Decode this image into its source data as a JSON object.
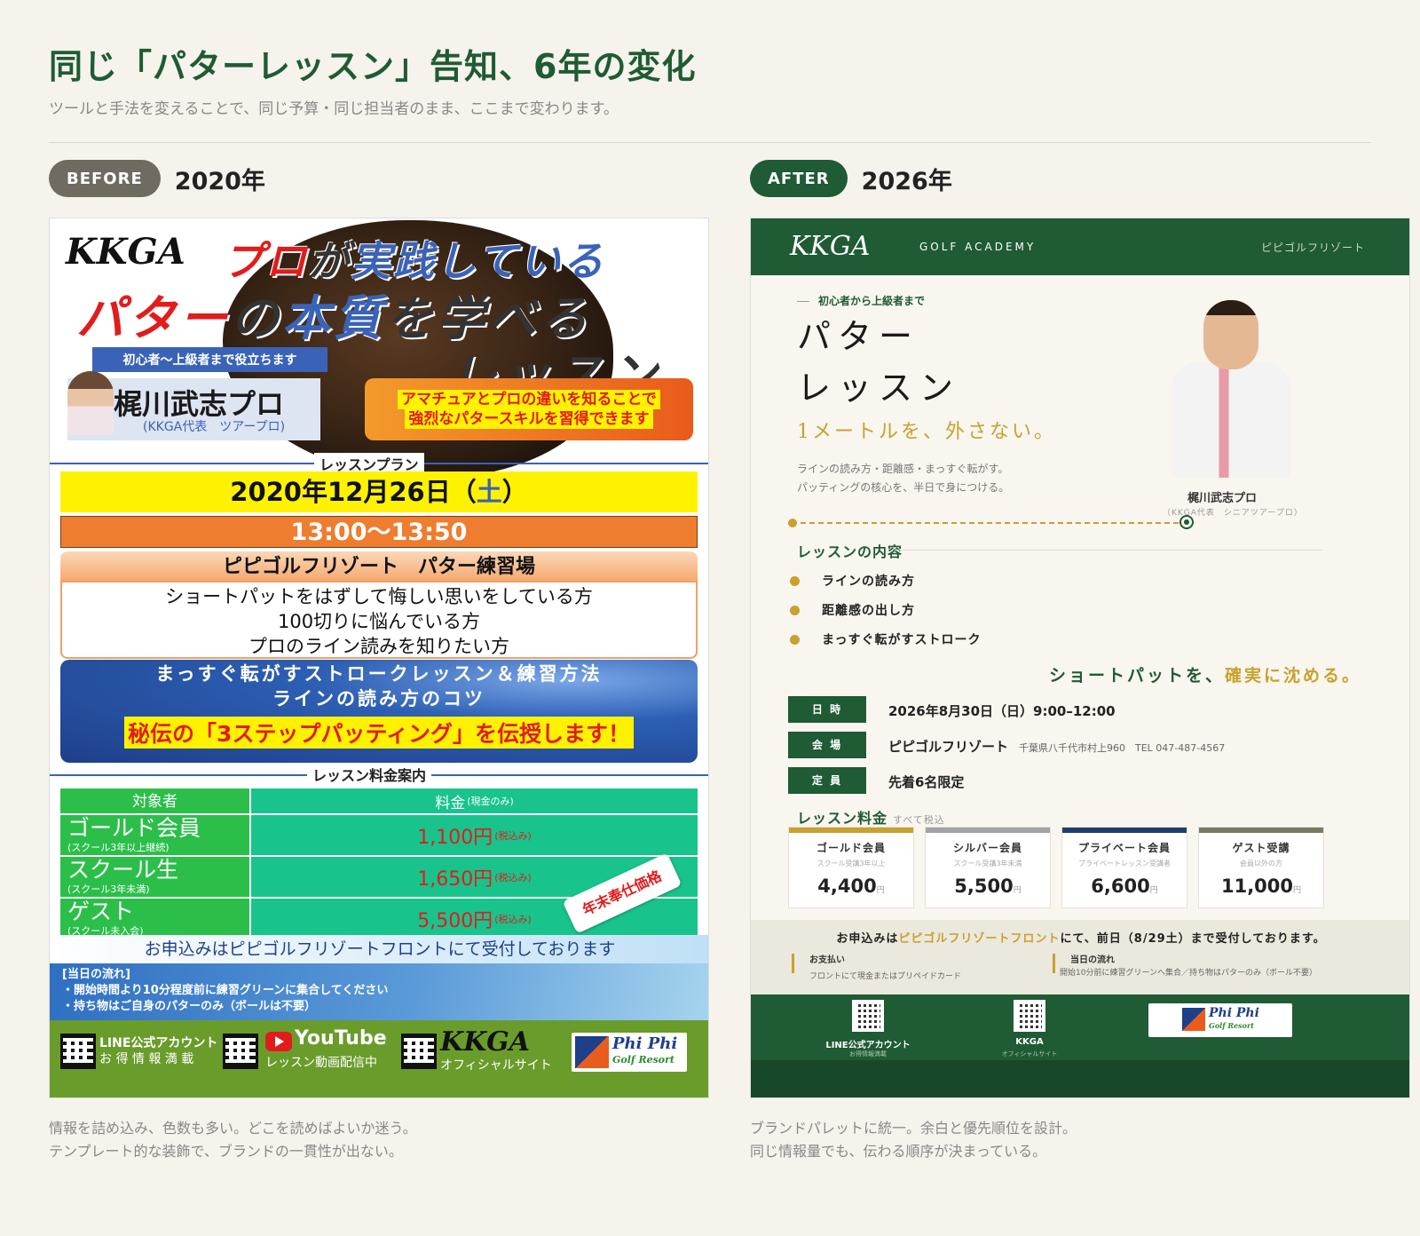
{
  "page": {
    "title": "同じ「パターレッスン」告知、6年の変化",
    "subtitle": "ツールと手法を変えることで、同じ予算・同じ担当者のまま、ここまで変わります。"
  },
  "before": {
    "tag": "BEFORE",
    "year": "2020年",
    "caption": [
      "情報を詰め込み、色数も多い。どこを読めばよいか迷う。",
      "テンプレート的な装飾で、ブランドの一貫性が出ない。"
    ],
    "flyer": {
      "logo": "KKGA",
      "headline1_red": "プロ",
      "headline1_mid": "が",
      "headline1_blue": "実践",
      "headline1_end": "している",
      "headline2_red": "パター",
      "headline2_mid": "の",
      "headline2_blue": "本質",
      "headline2_end": "を学べる",
      "headline3": "レッスン",
      "ribbon": "初心者～上級者まで役立ちます",
      "pro_name": "梶川武志プロ",
      "pro_role": "(KKGA代表　ツアープロ)",
      "amateur_line1": "アマチュアとプロの違いを知ることで",
      "amateur_line2": "強烈なパタースキルを習得できます",
      "plan_label": "レッスンプラン",
      "date_main": "2020年12月26日（",
      "date_day": "土",
      "date_close": "）",
      "time": "13:00～13:50",
      "venue": "ピピゴルフリゾート　パター練習場",
      "targets": [
        "ショートパットをはずして悔しい思いをしている方",
        "100切りに悩んでいる方",
        "プロのライン読みを知りたい方"
      ],
      "blue_line1": "まっすぐ転がすストロークレッスン＆練習方法",
      "blue_line2": "ラインの読み方のコツ",
      "blue_line3": "秘伝の「3ステップパッティング」を伝授します！",
      "fee_label": "レッスン料金案内",
      "table_head_target": "対象者",
      "table_head_fee": "料金",
      "table_head_fee_note": "(現金のみ)",
      "rows": [
        {
          "name": "ゴールド会員",
          "note": "(スクール3年以上継続)",
          "price": "1,100円",
          "tax": "(税込み)"
        },
        {
          "name": "スクール生",
          "note": "(スクール3年未満)",
          "price": "1,650円",
          "tax": "(税込み)"
        },
        {
          "name": "ゲスト",
          "note": "(スクール未入会)",
          "price": "5,500円",
          "tax": "(税込み)"
        }
      ],
      "stamp": "年末奉仕価格",
      "apply": "お申込みはピピゴルフリゾートフロントにて受付しております",
      "flow_title": "[当日の流れ]",
      "flow_1": "・開始時間より10分程度前に練習グリーンに集合してください",
      "flow_2": "・持ち物はご自身のパターのみ（ボールは不要）",
      "footer_line_1": "LINE公式アカウント",
      "footer_line_2": "お 得 情 報 満 載",
      "footer_yt_1": "YouTube",
      "footer_yt_2": "レッスン動画配信中",
      "footer_kkga_1": "KKGA",
      "footer_kkga_2": "オフィシャルサイト",
      "footer_pp_1": "Phi Phi",
      "footer_pp_2": "Golf Resort"
    }
  },
  "after": {
    "tag": "AFTER",
    "year": "2026年",
    "caption": [
      "ブランドパレットに統一。余白と優先順位を設計。",
      "同じ情報量でも、伝わる順序が決まっている。"
    ],
    "flyer": {
      "logo": "KKGA",
      "academy": "GOLF ACADEMY",
      "resort": "ピピゴルフリゾート",
      "eyebrow": "初心者から上級者まで",
      "title_1": "パター",
      "title_2": "レッスン",
      "tagline": "1メートルを、外さない。",
      "desc_1": "ラインの読み方・距離感・まっすぐ転がす。",
      "desc_2": "パッティングの核心を、半日で身につける。",
      "pro_name": "梶川武志プロ",
      "pro_role": "（KKGA代表　シニアツアープロ）",
      "content_title": "レッスンの内容",
      "items": [
        "ラインの読み方",
        "距離感の出し方",
        "まっすぐ転がすストローク"
      ],
      "claim_1": "ショートパットを、",
      "claim_2": "確実に沈める。",
      "date_label": "日 時",
      "date_value": "2026年8月30日（日）9:00–12:00",
      "venue_label": "会 場",
      "venue_value": "ピピゴルフリゾート",
      "venue_addr": "千葉県八千代市村上960　TEL 047-487-4567",
      "cap_label": "定 員",
      "cap_value": "先着6名限定",
      "fee_title": "レッスン料金",
      "fee_note": "すべて税込",
      "fees": [
        {
          "name": "ゴールド会員",
          "desc": "スクール受講3年以上",
          "price": "4,400",
          "unit": "円",
          "color": "#c8a12e"
        },
        {
          "name": "シルバー会員",
          "desc": "スクール受講3年未満",
          "price": "5,500",
          "unit": "円",
          "color": "#a3a3a3"
        },
        {
          "name": "プライベート会員",
          "desc": "プライベートレッスン受講者",
          "price": "6,600",
          "unit": "円",
          "color": "#1e3f6e"
        },
        {
          "name": "ゲスト受講",
          "desc": "会員以外の方",
          "price": "11,000",
          "unit": "円",
          "color": "#7a7a63"
        }
      ],
      "apply_1": "お申込みは",
      "apply_2": "ピピゴルフリゾートフロント",
      "apply_3": "にて、前日（8/29土）まで受付しております。",
      "pay_title": "お支払い",
      "pay_desc": "フロントにて現金またはプリペイドカード",
      "flow_title": "当日の流れ",
      "flow_desc": "開始10分前に練習グリーンへ集合／持ち物はパターのみ（ボール不要）",
      "foot_line_t": "LINE公式アカウント",
      "foot_line_s": "お得情報満載",
      "foot_kkga_t": "KKGA",
      "foot_kkga_s": "オフィシャルサイト",
      "foot_pp_1": "Phi Phi",
      "foot_pp_2": "Golf Resort"
    }
  }
}
